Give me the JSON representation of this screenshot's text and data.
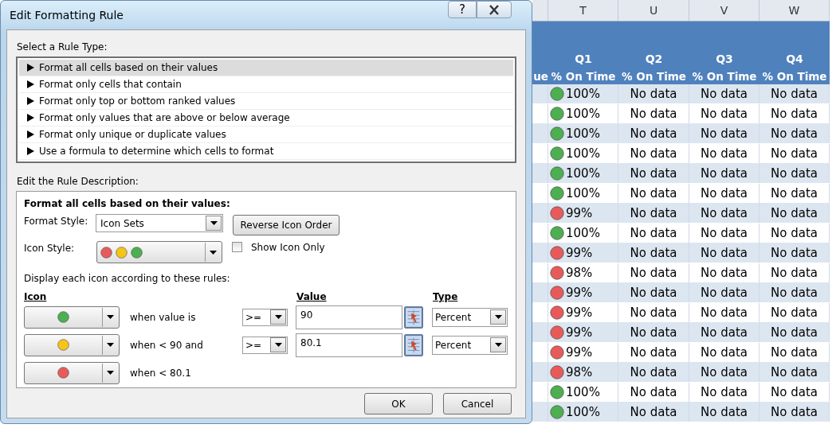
{
  "dialog": {
    "title": "Edit Formatting Rule",
    "help_button": "?",
    "rule_type_label": "Select a Rule Type:",
    "rule_types": [
      {
        "label": "Format all cells based on their values",
        "selected": true
      },
      {
        "label": "Format only cells that contain",
        "selected": false
      },
      {
        "label": "Format only top or bottom ranked values",
        "selected": false
      },
      {
        "label": "Format only values that are above or below average",
        "selected": false
      },
      {
        "label": "Format only unique or duplicate values",
        "selected": false
      },
      {
        "label": "Use a formula to determine which cells to format",
        "selected": false
      }
    ],
    "description_label": "Edit the Rule Description:",
    "description": {
      "heading": "Format all cells based on their values:",
      "format_style_label": "Format Style:",
      "format_style": "Icon Sets",
      "reverse_button": "Reverse Icon Order",
      "icon_style_label": "Icon Style:",
      "icon_style_colors": [
        {
          "color": "#e85a5a"
        },
        {
          "color": "#f5c518"
        },
        {
          "color": "#4caf50"
        }
      ],
      "show_icon_only": {
        "label": "Show Icon Only",
        "checked": false
      },
      "rules_intro": "Display each icon according to these rules:",
      "columns": {
        "icon": "Icon",
        "value": "Value",
        "type": "Type"
      },
      "rules": [
        {
          "color": "#4caf50",
          "condition": "when value is",
          "operator": ">=",
          "value": "90",
          "type": "Percent"
        },
        {
          "color": "#f5c518",
          "condition": "when < 90 and",
          "operator": ">=",
          "value": "80.1",
          "type": "Percent"
        },
        {
          "color": "#e85a5a",
          "condition": "when < 80.1"
        }
      ]
    },
    "buttons": [
      "OK",
      "Cancel"
    ]
  },
  "sheet": {
    "partial_header": "ue",
    "columns": [
      "T",
      "U",
      "V",
      "W"
    ],
    "headers": [
      {
        "quarter": "Q1",
        "label": "% On Time"
      },
      {
        "quarter": "Q2",
        "label": "% On Time"
      },
      {
        "quarter": "Q3",
        "label": "% On Time"
      },
      {
        "quarter": "Q4",
        "label": "% On Time"
      }
    ],
    "rows": [
      {
        "color": "#4caf50",
        "cells": [
          "100%",
          "No data",
          "No data",
          "No data"
        ]
      },
      {
        "color": "#4caf50",
        "cells": [
          "100%",
          "No data",
          "No data",
          "No data"
        ]
      },
      {
        "color": "#4caf50",
        "cells": [
          "100%",
          "No data",
          "No data",
          "No data"
        ]
      },
      {
        "color": "#4caf50",
        "cells": [
          "100%",
          "No data",
          "No data",
          "No data"
        ]
      },
      {
        "color": "#4caf50",
        "cells": [
          "100%",
          "No data",
          "No data",
          "No data"
        ]
      },
      {
        "color": "#4caf50",
        "cells": [
          "100%",
          "No data",
          "No data",
          "No data"
        ]
      },
      {
        "color": "#e85a5a",
        "cells": [
          "99%",
          "No data",
          "No data",
          "No data"
        ]
      },
      {
        "color": "#4caf50",
        "cells": [
          "100%",
          "No data",
          "No data",
          "No data"
        ]
      },
      {
        "color": "#e85a5a",
        "cells": [
          "99%",
          "No data",
          "No data",
          "No data"
        ]
      },
      {
        "color": "#e85a5a",
        "cells": [
          "98%",
          "No data",
          "No data",
          "No data"
        ]
      },
      {
        "color": "#e85a5a",
        "cells": [
          "99%",
          "No data",
          "No data",
          "No data"
        ]
      },
      {
        "color": "#e85a5a",
        "cells": [
          "99%",
          "No data",
          "No data",
          "No data"
        ]
      },
      {
        "color": "#e85a5a",
        "cells": [
          "99%",
          "No data",
          "No data",
          "No data"
        ]
      },
      {
        "color": "#e85a5a",
        "cells": [
          "99%",
          "No data",
          "No data",
          "No data"
        ]
      },
      {
        "color": "#e85a5a",
        "cells": [
          "98%",
          "No data",
          "No data",
          "No data"
        ]
      },
      {
        "color": "#4caf50",
        "cells": [
          "100%",
          "No data",
          "No data",
          "No data"
        ]
      },
      {
        "color": "#4caf50",
        "cells": [
          "100%",
          "No data",
          "No data",
          "No data"
        ]
      }
    ]
  }
}
